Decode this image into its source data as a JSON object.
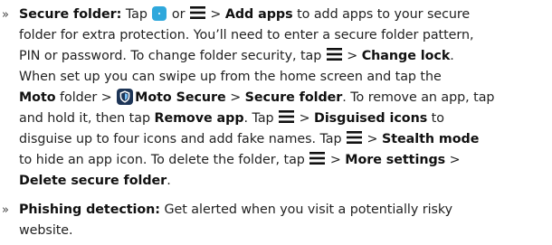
{
  "bullet": "»",
  "secure": {
    "heading": "Secure folder:",
    "tap": "Tap",
    "or": "or",
    "gt": ">",
    "add_apps": "Add apps",
    "l1_rest": "to add apps to your secure",
    "line2": "folder for extra protection. You’ll need to enter a secure folder pattern,",
    "l3_a": "PIN or password. To change folder security, tap",
    "change_lock": "Change lock",
    "period": ".",
    "line4": "When set up you can swipe up from the home screen and tap the",
    "moto": "Moto",
    "l5_b": "folder >",
    "moto_secure": "Moto Secure",
    "secure_folder": "Secure folder",
    "l5_c": ". To remove an app, tap",
    "l6_a": "and hold it, then tap",
    "remove_app": "Remove app",
    "l6_b": ". Tap",
    "disguised_icons": "Disguised icons",
    "l6_c": "to",
    "l7_a": "disguise up to four icons and add fake names. Tap",
    "stealth_mode": "Stealth mode",
    "l8_a": "to hide an app icon. To delete the folder, tap",
    "more_settings": "More settings",
    "delete_folder": "Delete secure folder"
  },
  "phishing": {
    "heading": "Phishing detection:",
    "l1_rest": "Get alerted when you visit a potentially risky",
    "l2": "website."
  },
  "icons": {
    "add_apps_icon": "add-apps-icon",
    "menu_icon": "menu-icon",
    "shield_icon": "moto-secure-shield-icon"
  },
  "colors": {
    "text": "#222222",
    "add_icon": "#2fa8dc",
    "shield": "#1d3557"
  }
}
